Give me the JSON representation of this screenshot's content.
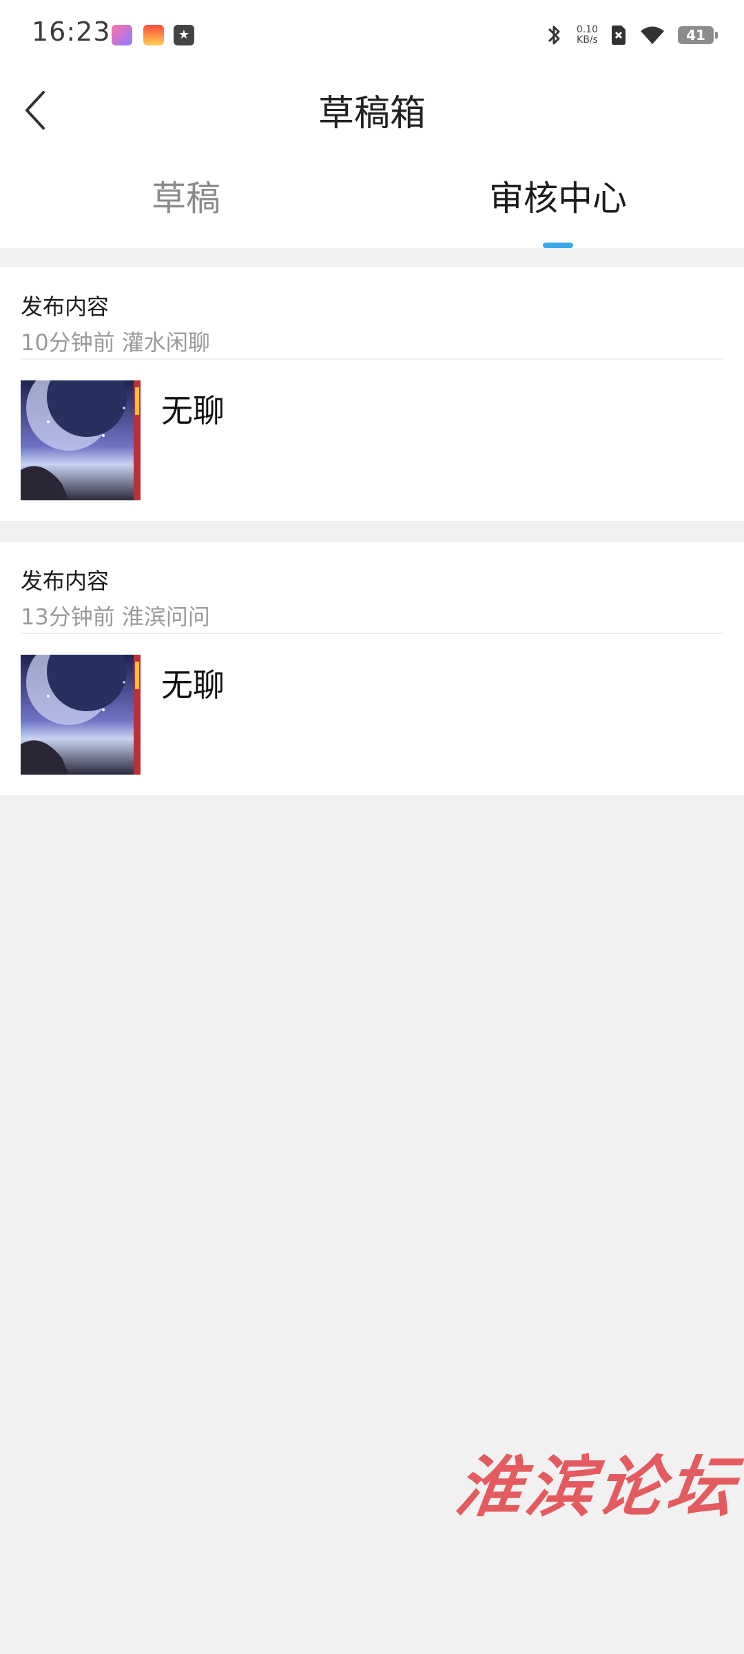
{
  "status_bar": {
    "time": "16:23",
    "net_speed_value": "0.10",
    "net_speed_unit": "KB/s",
    "battery": "41"
  },
  "header": {
    "title": "草稿箱"
  },
  "tabs": [
    {
      "label": "草稿",
      "active": false
    },
    {
      "label": "审核中心",
      "active": true
    }
  ],
  "accent_color": "#3aa7e8",
  "posts": [
    {
      "title": "发布内容",
      "meta": "10分钟前 灌水闲聊",
      "body": "无聊"
    },
    {
      "title": "发布内容",
      "meta": "13分钟前 淮滨问问",
      "body": "无聊"
    }
  ],
  "watermark": "淮滨论坛"
}
